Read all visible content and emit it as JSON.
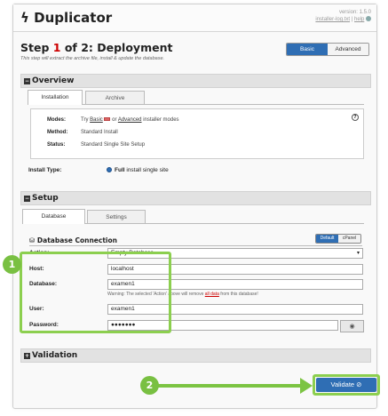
{
  "header": {
    "app_title": "Duplicator",
    "version": "version: 1.5.0",
    "links": [
      "installer-log.txt",
      "help"
    ],
    "separator": "|"
  },
  "step": {
    "prefix": "Step",
    "number": "1",
    "suffix": "of 2: Deployment",
    "subtitle": "This step will extract the archive file, install & update the database."
  },
  "mode_toggle": {
    "basic": "Basic",
    "advanced": "Advanced",
    "selected": "Basic"
  },
  "overview": {
    "title": "Overview",
    "tabs": [
      {
        "label": "Installation",
        "active": true
      },
      {
        "label": "Archive",
        "active": false
      }
    ],
    "modes_label": "Modes:",
    "modes_value": {
      "try": "Try",
      "basic": "Basic",
      "or": "or",
      "advanced": "Advanced",
      "rest": "installer modes"
    },
    "method_label": "Method:",
    "method_value": "Standard Install",
    "status_label": "Status:",
    "status_value": "Standard Single Site Setup",
    "install_type_label": "Install Type:",
    "install_type_value_bold": "Full",
    "install_type_value_rest": "install single site"
  },
  "setup": {
    "title": "Setup",
    "tabs": [
      {
        "label": "Database",
        "active": true
      },
      {
        "label": "Settings",
        "active": false
      }
    ],
    "db_connection_title": "Database Connection",
    "db_toggle": {
      "default": "Default",
      "cpanel": "cPanel",
      "selected": "Default"
    },
    "fields": {
      "action": {
        "label": "Action:",
        "value": "Empty Database"
      },
      "host": {
        "label": "Host:",
        "value": "localhost"
      },
      "database": {
        "label": "Database:",
        "value": "examen1"
      },
      "user": {
        "label": "User:",
        "value": "examen1"
      },
      "password": {
        "label": "Password:",
        "value": "●●●●●●●"
      }
    },
    "warning": {
      "before": "Warning: The selected 'Action' above will remove",
      "highlight": "all data",
      "after": "from this database!"
    }
  },
  "validation": {
    "title": "Validation"
  },
  "buttons": {
    "validate": "Validate ⊘"
  },
  "callouts": [
    "1",
    "2"
  ],
  "colors": {
    "accent": "#2f6eb4",
    "callout_green": "#79c042",
    "highlight_green": "#8ccf4f",
    "step_red": "#cc0000"
  },
  "icons": {
    "header_logo": "bolt-icon",
    "overview_toggle": "collapse-square-icon",
    "setup_toggle": "collapse-square-icon",
    "validation_toggle": "expand-square-icon",
    "db_connection": "database-icon",
    "password_reveal": "eye-icon",
    "info": "question-circle-icon"
  }
}
